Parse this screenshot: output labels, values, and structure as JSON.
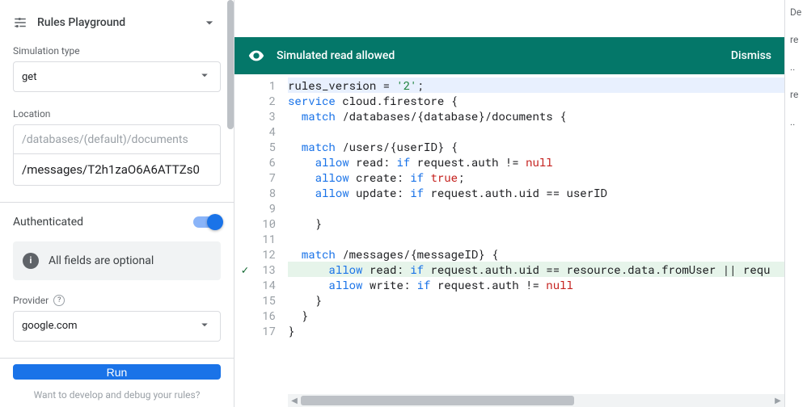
{
  "panel": {
    "title": "Rules Playground",
    "sim_type_label": "Simulation type",
    "sim_type_value": "get",
    "location_label": "Location",
    "location_prefix": "/databases/(default)/documents",
    "location_value": "/messages/T2h1zaO6A6ATTZs0",
    "auth_label": "Authenticated",
    "info_text": "All fields are optional",
    "provider_label": "Provider",
    "provider_value": "google.com",
    "run_label": "Run",
    "hint": "Want to develop and debug your rules?"
  },
  "status": {
    "message": "Simulated read allowed",
    "dismiss": "Dismiss"
  },
  "code": {
    "lines": [
      {
        "n": 1,
        "hl": "blue",
        "t": [
          [
            "",
            "rules_version = "
          ],
          [
            "str",
            "'2'"
          ],
          [
            "",
            ";"
          ]
        ]
      },
      {
        "n": 2,
        "t": [
          [
            "kw",
            "service"
          ],
          [
            "",
            " cloud.firestore {"
          ]
        ]
      },
      {
        "n": 3,
        "t": [
          [
            "",
            "  "
          ],
          [
            "kw",
            "match"
          ],
          [
            "",
            " /databases/{database}/documents {"
          ]
        ]
      },
      {
        "n": 4,
        "t": [
          [
            "",
            ""
          ]
        ]
      },
      {
        "n": 5,
        "t": [
          [
            "",
            "  "
          ],
          [
            "kw",
            "match"
          ],
          [
            "",
            " /users/{userID} {"
          ]
        ]
      },
      {
        "n": 6,
        "t": [
          [
            "",
            "    "
          ],
          [
            "kw",
            "allow"
          ],
          [
            "",
            " read: "
          ],
          [
            "kw",
            "if"
          ],
          [
            "",
            " request.auth != "
          ],
          [
            "bool",
            "null"
          ]
        ]
      },
      {
        "n": 7,
        "t": [
          [
            "",
            "    "
          ],
          [
            "kw",
            "allow"
          ],
          [
            "",
            " create: "
          ],
          [
            "kw",
            "if"
          ],
          [
            "",
            " "
          ],
          [
            "bool",
            "true"
          ],
          [
            "",
            ";"
          ]
        ]
      },
      {
        "n": 8,
        "t": [
          [
            "",
            "    "
          ],
          [
            "kw",
            "allow"
          ],
          [
            "",
            " update: "
          ],
          [
            "kw",
            "if"
          ],
          [
            "",
            " request.auth.uid == userID"
          ]
        ]
      },
      {
        "n": 9,
        "t": [
          [
            "",
            ""
          ]
        ]
      },
      {
        "n": 10,
        "t": [
          [
            "",
            "    }"
          ]
        ]
      },
      {
        "n": 11,
        "t": [
          [
            "",
            ""
          ]
        ]
      },
      {
        "n": 12,
        "t": [
          [
            "",
            "  "
          ],
          [
            "kw",
            "match"
          ],
          [
            "",
            " /messages/{messageID} {"
          ]
        ]
      },
      {
        "n": 13,
        "hl": "green",
        "mark": true,
        "t": [
          [
            "",
            "      "
          ],
          [
            "kw",
            "allow"
          ],
          [
            "",
            " read: "
          ],
          [
            "kw",
            "if"
          ],
          [
            "",
            " request.auth.uid == resource.data.fromUser || requ"
          ]
        ]
      },
      {
        "n": 14,
        "t": [
          [
            "",
            "      "
          ],
          [
            "kw",
            "allow"
          ],
          [
            "",
            " write: "
          ],
          [
            "kw",
            "if"
          ],
          [
            "",
            " request.auth != "
          ],
          [
            "bool",
            "null"
          ]
        ]
      },
      {
        "n": 15,
        "t": [
          [
            "",
            "    }"
          ]
        ]
      },
      {
        "n": 16,
        "t": [
          [
            "",
            "  }"
          ]
        ]
      },
      {
        "n": 17,
        "t": [
          [
            "",
            "}"
          ]
        ]
      }
    ]
  },
  "rightcol": [
    "De",
    "re",
    "..",
    "re",
    ".."
  ]
}
